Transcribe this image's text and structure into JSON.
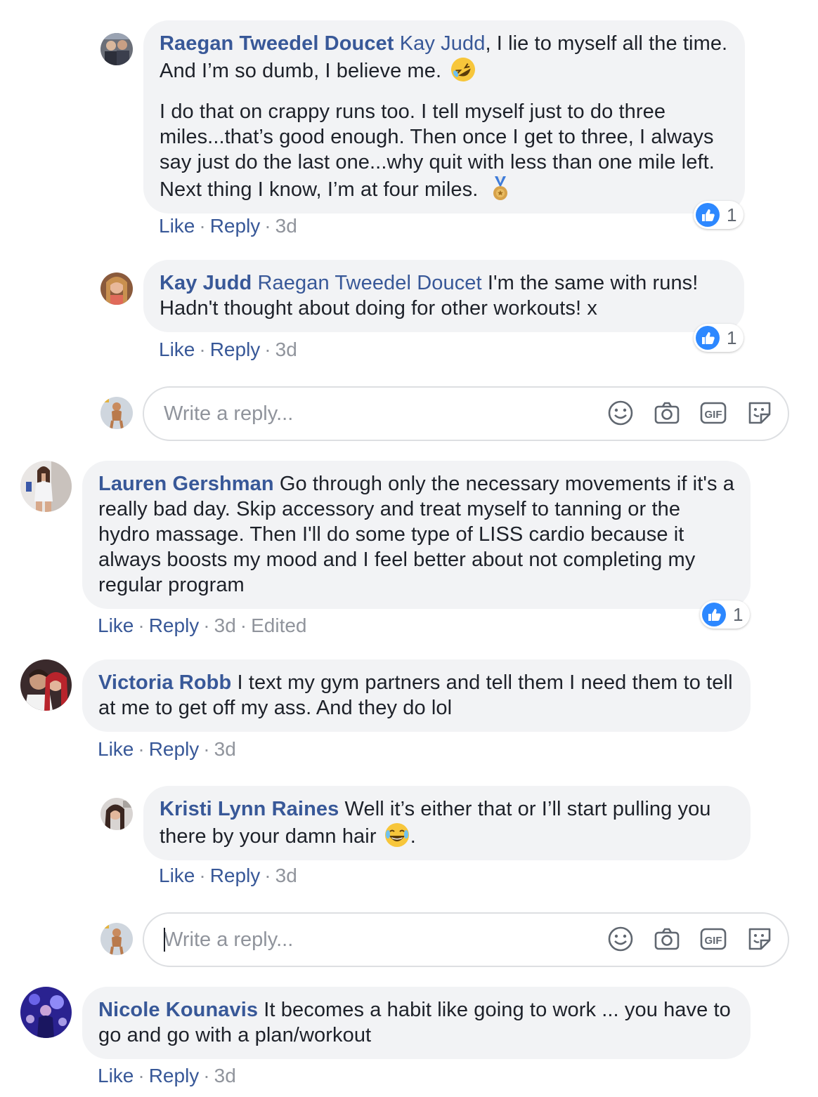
{
  "comments": [
    {
      "author": "Raegan Tweedel Doucet",
      "mention": "Kay Judd",
      "text1": ", I lie to myself all the time. And I’m so dumb, I believe me.",
      "text2": "I do that on crappy runs too. I tell myself just to do three miles...that’s good enough. Then once I get to three, I always say just do the last one...why quit with less than one mile left. Next thing I know, I’m at four miles.",
      "like": "Like",
      "reply": "Reply",
      "time": "3d",
      "reactions": "1"
    },
    {
      "author": "Kay Judd",
      "mention": "Raegan Tweedel Doucet",
      "text1": "I'm the same with runs! Hadn't thought about doing for other workouts! x",
      "like": "Like",
      "reply": "Reply",
      "time": "3d",
      "reactions": "1"
    },
    {
      "author": "Lauren Gershman",
      "text1": "Go through only the necessary movements if it's a really bad day. Skip accessory and treat myself to tanning or the hydro massage. Then I'll do some type of LISS cardio because it always boosts my mood and I feel better about not completing my regular program",
      "like": "Like",
      "reply": "Reply",
      "time": "3d",
      "edited": "Edited",
      "reactions": "1"
    },
    {
      "author": "Victoria Robb",
      "text1": "I text my gym partners and tell them I need them to tell at me to get off my ass. And they do lol",
      "like": "Like",
      "reply": "Reply",
      "time": "3d"
    },
    {
      "author": "Kristi Lynn Raines",
      "text1": "Well it’s either that or I’ll start pulling you there by your damn hair",
      "text_end": ".",
      "like": "Like",
      "reply": "Reply",
      "time": "3d"
    },
    {
      "author": "Nicole Kounavis",
      "text1": "It becomes a habit like going to work ... you have to go and go with a plan/workout",
      "like": "Like",
      "reply": "Reply",
      "time": "3d"
    }
  ],
  "reply_box": {
    "placeholder": "Write a reply...",
    "icons": [
      "smiley-icon",
      "camera-icon",
      "gif-icon",
      "sticker-icon"
    ],
    "gif_label": "GIF"
  },
  "colors": {
    "link": "#385898",
    "bubble": "#f2f3f5",
    "meta": "#90949c",
    "like_blue": "#2d88ff"
  }
}
